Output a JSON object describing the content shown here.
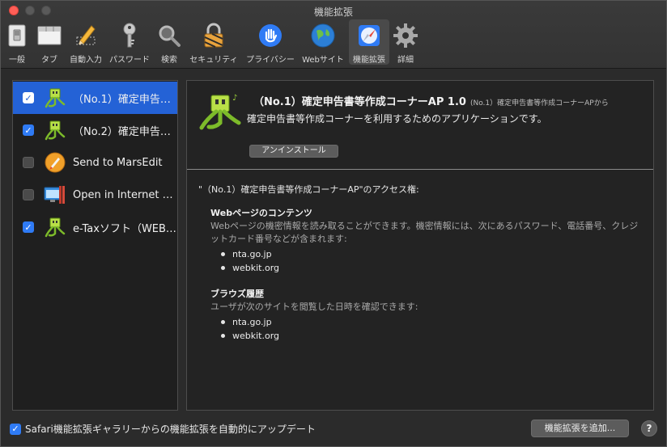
{
  "window": {
    "title": "機能拡張"
  },
  "toolbar": {
    "items": [
      {
        "label": "一般",
        "icon": "general-switch-icon"
      },
      {
        "label": "タブ",
        "icon": "tabs-icon"
      },
      {
        "label": "自動入力",
        "icon": "autofill-pencil-icon"
      },
      {
        "label": "パスワード",
        "icon": "key-icon"
      },
      {
        "label": "検索",
        "icon": "magnifier-icon"
      },
      {
        "label": "セキュリティ",
        "icon": "lock-icon"
      },
      {
        "label": "プライバシー",
        "icon": "hand-icon"
      },
      {
        "label": "Webサイト",
        "icon": "globe-icon"
      },
      {
        "label": "機能拡張",
        "icon": "extensions-icon"
      },
      {
        "label": "詳細",
        "icon": "gear-icon"
      }
    ],
    "active_index": 8
  },
  "sidebar": {
    "items": [
      {
        "name": "（No.1）確定申告書…",
        "checked": true,
        "selected": true,
        "icon": "tax-mascot-icon"
      },
      {
        "name": "（No.2）確定申告…",
        "checked": true,
        "selected": false,
        "icon": "tax-mascot-icon"
      },
      {
        "name": "Send to MarsEdit",
        "checked": false,
        "selected": false,
        "icon": "marsedit-rocket-icon"
      },
      {
        "name": "Open in Internet E…",
        "checked": false,
        "selected": false,
        "icon": "internet-explorer-window-icon"
      },
      {
        "name": "e-Taxソフト（WEB…",
        "checked": true,
        "selected": false,
        "icon": "tax-mascot-icon"
      }
    ]
  },
  "detail": {
    "title": "（No.1）確定申告書等作成コーナーAP 1.0",
    "from": "(No.1）確定申告書等作成コーナーAPから",
    "description": "確定申告書等作成コーナーを利用するためのアプリケーションです。",
    "uninstall_label": "アンインストール",
    "permissions_title": "\"（No.1）確定申告書等作成コーナーAP\"のアクセス権:",
    "sections": [
      {
        "title": "Webページのコンテンツ",
        "description": "Webページの機密情報を読み取ることができます。機密情報には、次にあるパスワード、電話番号、クレジットカード番号などが含まれます:",
        "sites": [
          "nta.go.jp",
          "webkit.org"
        ]
      },
      {
        "title": "ブラウズ履歴",
        "description": "ユーザが次のサイトを閲覧した日時を確認できます:",
        "sites": [
          "nta.go.jp",
          "webkit.org"
        ]
      }
    ]
  },
  "footer": {
    "auto_update_label": "Safari機能拡張ギャラリーからの機能拡張を自動的にアップデート",
    "auto_update_checked": true,
    "add_button_label": "機能拡張を追加...",
    "help_label": "?"
  },
  "colors": {
    "selection": "#2462d6",
    "checkbox": "#2f7bf5",
    "window_bg": "#2b2b2b"
  }
}
